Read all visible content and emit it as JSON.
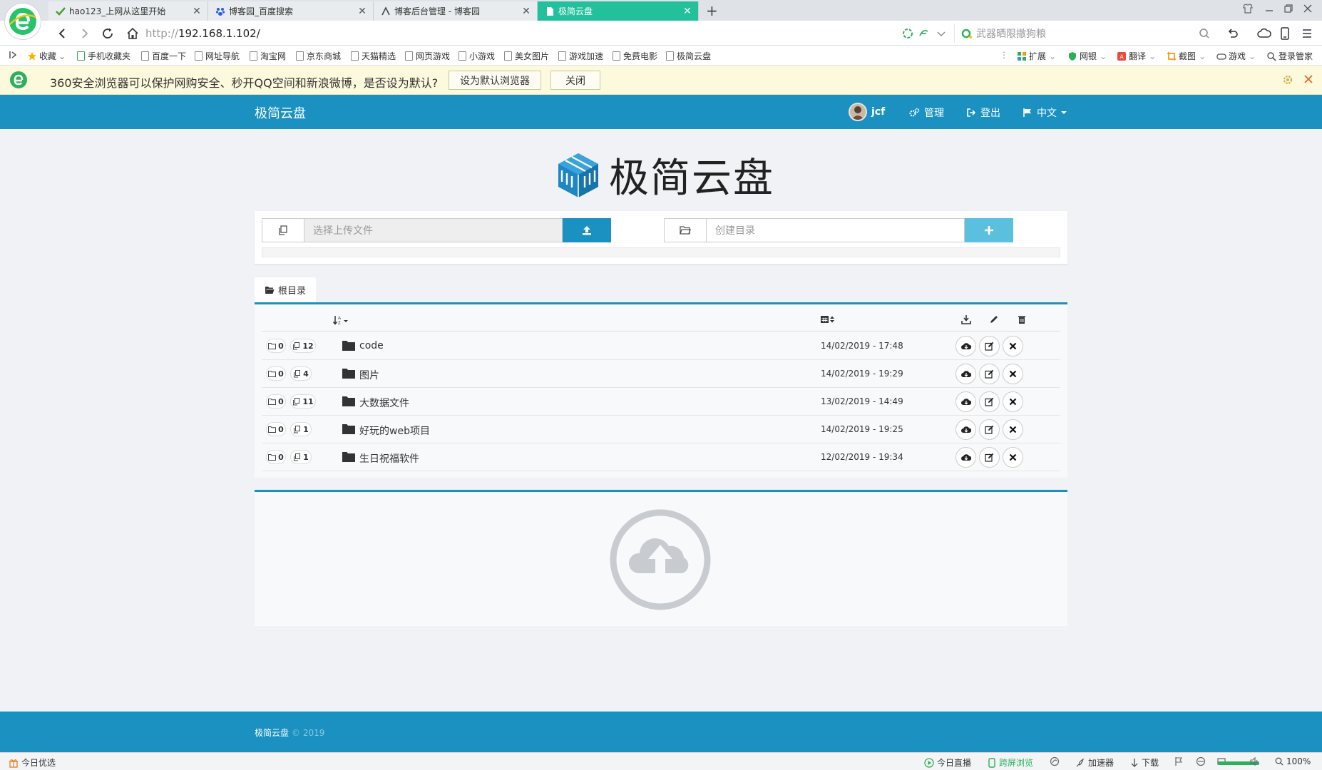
{
  "browser": {
    "tabs": [
      {
        "label": "hao123_上网从这里开始",
        "active": false
      },
      {
        "label": "博客园_百度搜索",
        "active": false
      },
      {
        "label": "博客后台管理 - 博客园",
        "active": false
      },
      {
        "label": "极简云盘",
        "active": true
      }
    ],
    "new_tab": "+",
    "address": {
      "protocol": "http://",
      "host": "192.168.1.102/"
    },
    "search_placeholder": "武器晒限撤狗粮",
    "bookmarks": [
      {
        "label": "收藏"
      },
      {
        "label": "手机收藏夹"
      },
      {
        "label": "百度一下"
      },
      {
        "label": "网址导航"
      },
      {
        "label": "淘宝网"
      },
      {
        "label": "京东商城"
      },
      {
        "label": "天猫精选"
      },
      {
        "label": "网页游戏"
      },
      {
        "label": "小游戏"
      },
      {
        "label": "美女图片"
      },
      {
        "label": "游戏加速"
      },
      {
        "label": "免费电影"
      },
      {
        "label": "极简云盘"
      }
    ],
    "bookmark_tools": {
      "extend": "扩展",
      "bank": "网银",
      "translate": "翻译",
      "screenshot": "截图",
      "game": "游戏",
      "login": "登录管家"
    },
    "infobar": {
      "message": "360安全浏览器可以保护网购安全、秒开QQ空间和新浪微博，是否设为默认?",
      "set_default": "设为默认浏览器",
      "close": "关闭"
    },
    "status": {
      "today_pick": "今日优选",
      "live": "今日直播",
      "cast": "跨屏浏览",
      "accelerate": "加速器",
      "download": "下载",
      "zoom": "100%"
    }
  },
  "app": {
    "brand": "极简云盘",
    "user": "jcf",
    "admin": "管理",
    "logout": "登出",
    "language": "中文",
    "logo_text": "极简云盘",
    "upload": {
      "placeholder": "选择上传文件"
    },
    "mkdir": {
      "placeholder": "创建目录"
    },
    "breadcrumb": "根目录",
    "rows": [
      {
        "dirs": "0",
        "files": "12",
        "name": "code",
        "date": "14/02/2019 - 17:48"
      },
      {
        "dirs": "0",
        "files": "4",
        "name": "图片",
        "date": "14/02/2019 - 19:29"
      },
      {
        "dirs": "0",
        "files": "11",
        "name": "大数据文件",
        "date": "13/02/2019 - 14:49"
      },
      {
        "dirs": "0",
        "files": "1",
        "name": "好玩的web项目",
        "date": "14/02/2019 - 19:25"
      },
      {
        "dirs": "0",
        "files": "1",
        "name": "生日祝福软件",
        "date": "12/02/2019 - 19:34"
      }
    ],
    "footer": {
      "brand": "极简云盘",
      "year": "© 2019"
    }
  },
  "colors": {
    "primary": "#1a91c0",
    "active_tab": "#22c19b",
    "upload_btn": "#1a91c0",
    "mkdir_btn": "#5bc0de"
  }
}
